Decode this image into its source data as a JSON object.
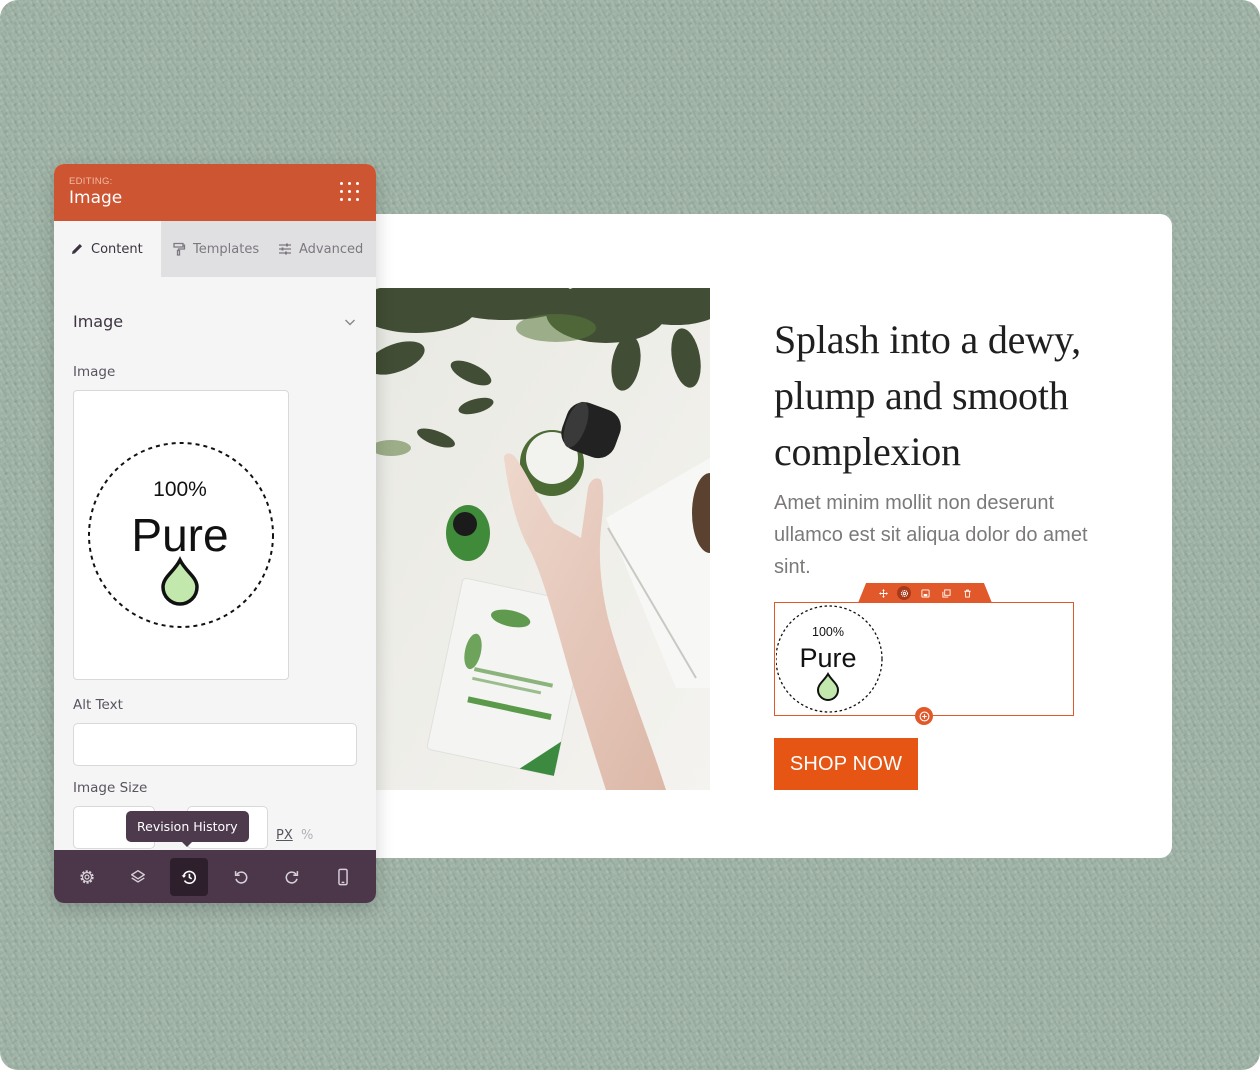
{
  "editor": {
    "editing_label": "EDITING:",
    "module_name": "Image",
    "tabs": [
      {
        "label": "Content",
        "icon": "pencil-icon",
        "active": true
      },
      {
        "label": "Templates",
        "icon": "paint-roller-icon",
        "active": false
      },
      {
        "label": "Advanced",
        "icon": "sliders-icon",
        "active": false
      }
    ],
    "section_title": "Image",
    "fields": {
      "image_label": "Image",
      "alt_text_label": "Alt Text",
      "alt_text_value": "",
      "image_size_label": "Image Size",
      "width_value": "",
      "height_value": "",
      "unit_px": "PX",
      "unit_percent": "%",
      "selected_unit": "PX"
    },
    "tooltip": "Revision History",
    "footer_buttons": [
      {
        "name": "settings",
        "icon": "gear-icon",
        "active": false
      },
      {
        "name": "layers",
        "icon": "layers-icon",
        "active": false
      },
      {
        "name": "revision-history",
        "icon": "history-icon",
        "active": true
      },
      {
        "name": "undo",
        "icon": "undo-icon",
        "active": false
      },
      {
        "name": "redo",
        "icon": "redo-icon",
        "active": false
      },
      {
        "name": "responsive-preview",
        "icon": "mobile-icon",
        "active": false
      }
    ]
  },
  "badge": {
    "percent": "100%",
    "word": "Pure",
    "drop_color": "#c2e8ad"
  },
  "preview": {
    "headline": "Splash into a dewy, plump and smooth complexion",
    "body": "Amet minim mollit non deserunt ullamco est sit aliqua dolor do amet sint.",
    "cta_label": "SHOP NOW",
    "module_toolbar": [
      "move-icon",
      "gear-icon",
      "save-icon",
      "duplicate-icon",
      "trash-icon"
    ],
    "photo_alt": "Hand reaching for green jar of face cream next to sheet mask and serum bottle under leaves"
  },
  "colors": {
    "accent": "#e1592a",
    "panel_header": "#cd5532",
    "cta": "#e65514",
    "footer": "#4b3749",
    "background": "#9fb3a6"
  }
}
